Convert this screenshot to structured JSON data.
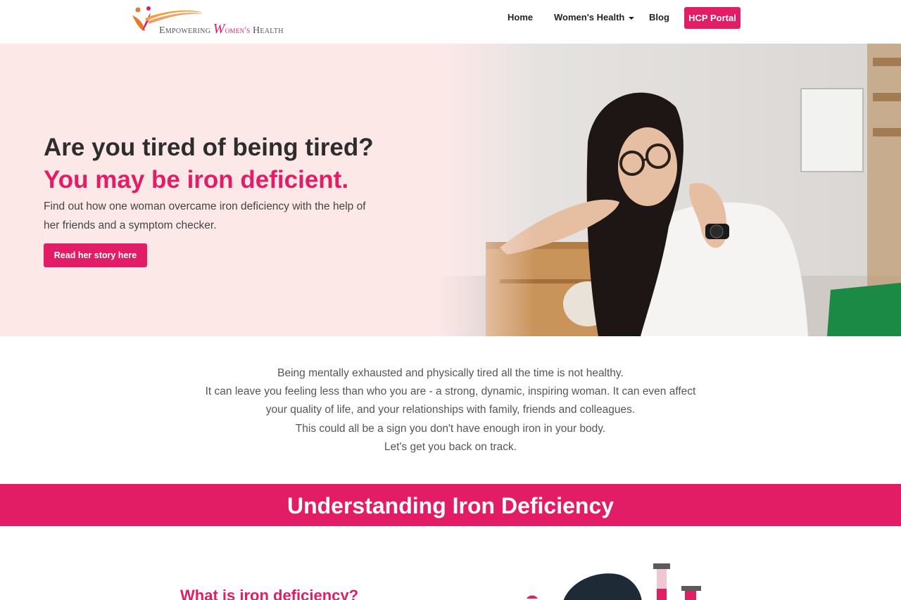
{
  "header": {
    "logo": {
      "word1": "Empowering",
      "word2_first": "W",
      "word2_rest": "omen's",
      "word3": "Health"
    },
    "nav": {
      "home": "Home",
      "womens_health": "Women's Health",
      "blog": "Blog",
      "hcp_portal": "HCP Portal"
    }
  },
  "hero": {
    "heading": "Are you tired of being tired?",
    "subheading": "You may be iron deficient.",
    "text": "Find out how one woman overcame iron deficiency with the help of her friends and a symptom checker.",
    "button": "Read her story here"
  },
  "intro": {
    "lines": [
      "Being mentally exhausted and physically tired all the time is not healthy.",
      "It can leave you feeling less than who you are - a strong, dynamic, inspiring woman. It can even affect your quality of life, and your relationships with family, friends and colleagues.",
      "This could all be a sign you don't have enough iron in your body.",
      "Let's get you back on track."
    ]
  },
  "band": {
    "title": "Understanding Iron Deficiency"
  },
  "section": {
    "heading": "What is iron deficiency?"
  },
  "colors": {
    "accent": "#e31d65",
    "hero_bg": "#fde8e8",
    "heading_dark": "#2d2d2d"
  }
}
